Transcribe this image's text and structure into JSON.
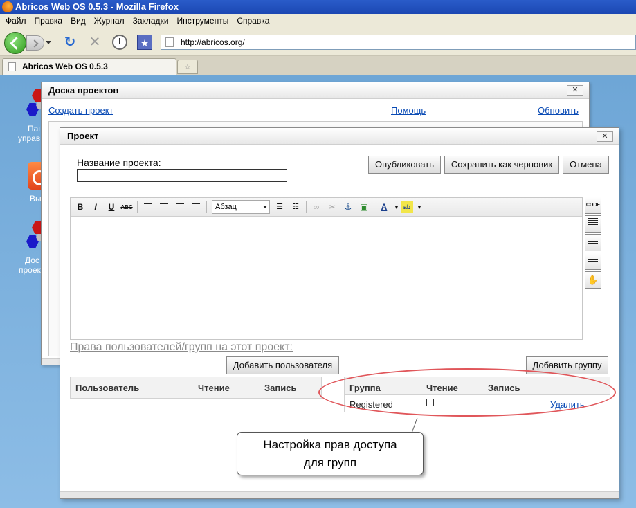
{
  "browser": {
    "window_title": "Abricos Web OS 0.5.3 - Mozilla Firefox",
    "menu": [
      "Файл",
      "Правка",
      "Вид",
      "Журнал",
      "Закладки",
      "Инструменты",
      "Справка"
    ],
    "url": "http://abricos.org/",
    "tab_title": "Abricos Web OS 0.5.3"
  },
  "desktop": {
    "icons": [
      {
        "label_1": "Пан",
        "label_2": "управ"
      },
      {
        "label_1": "Вы"
      },
      {
        "label_1": "Дос",
        "label_2": "проек"
      }
    ]
  },
  "board_window": {
    "title": "Доска проектов",
    "close": "✕",
    "links": {
      "create": "Создать проект",
      "help": "Помощь",
      "refresh": "Обновить"
    }
  },
  "project_window": {
    "title": "Проект",
    "close": "✕",
    "name_label": "Название проекта:",
    "name_value": "",
    "buttons": {
      "publish": "Опубликовать",
      "save_draft": "Сохранить как черновик",
      "cancel": "Отмена"
    },
    "editor": {
      "bold": "B",
      "italic": "I",
      "underline": "U",
      "strike": "ABC",
      "format": "Абзац",
      "code": "CODE"
    },
    "rights_title": "Права пользователей/групп на этот проект:",
    "add_user": "Добавить пользователя",
    "add_group": "Добавить группу",
    "users_table": {
      "headers": [
        "Пользователь",
        "Чтение",
        "Запись"
      ]
    },
    "groups_table": {
      "headers": [
        "Группа",
        "Чтение",
        "Запись"
      ],
      "rows": [
        {
          "group": "Registered",
          "read": false,
          "write": false,
          "action": "Удалить"
        }
      ]
    }
  },
  "annotation": {
    "line1": "Настройка прав доступа",
    "line2": "для групп",
    "color": "#e0565a"
  }
}
